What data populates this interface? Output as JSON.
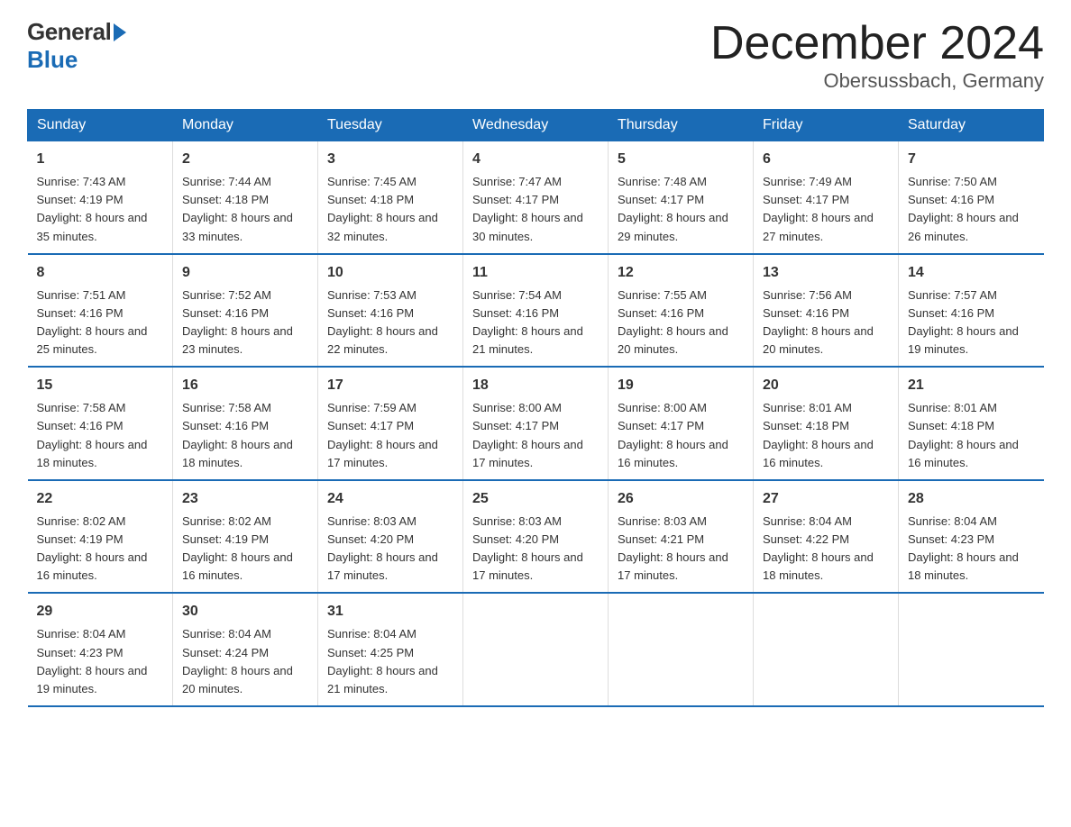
{
  "header": {
    "logo_text": "General",
    "logo_blue": "Blue",
    "month_title": "December 2024",
    "location": "Obersussbach, Germany"
  },
  "weekdays": [
    "Sunday",
    "Monday",
    "Tuesday",
    "Wednesday",
    "Thursday",
    "Friday",
    "Saturday"
  ],
  "weeks": [
    [
      {
        "day": "1",
        "sunrise": "7:43 AM",
        "sunset": "4:19 PM",
        "daylight": "8 hours and 35 minutes."
      },
      {
        "day": "2",
        "sunrise": "7:44 AM",
        "sunset": "4:18 PM",
        "daylight": "8 hours and 33 minutes."
      },
      {
        "day": "3",
        "sunrise": "7:45 AM",
        "sunset": "4:18 PM",
        "daylight": "8 hours and 32 minutes."
      },
      {
        "day": "4",
        "sunrise": "7:47 AM",
        "sunset": "4:17 PM",
        "daylight": "8 hours and 30 minutes."
      },
      {
        "day": "5",
        "sunrise": "7:48 AM",
        "sunset": "4:17 PM",
        "daylight": "8 hours and 29 minutes."
      },
      {
        "day": "6",
        "sunrise": "7:49 AM",
        "sunset": "4:17 PM",
        "daylight": "8 hours and 27 minutes."
      },
      {
        "day": "7",
        "sunrise": "7:50 AM",
        "sunset": "4:16 PM",
        "daylight": "8 hours and 26 minutes."
      }
    ],
    [
      {
        "day": "8",
        "sunrise": "7:51 AM",
        "sunset": "4:16 PM",
        "daylight": "8 hours and 25 minutes."
      },
      {
        "day": "9",
        "sunrise": "7:52 AM",
        "sunset": "4:16 PM",
        "daylight": "8 hours and 23 minutes."
      },
      {
        "day": "10",
        "sunrise": "7:53 AM",
        "sunset": "4:16 PM",
        "daylight": "8 hours and 22 minutes."
      },
      {
        "day": "11",
        "sunrise": "7:54 AM",
        "sunset": "4:16 PM",
        "daylight": "8 hours and 21 minutes."
      },
      {
        "day": "12",
        "sunrise": "7:55 AM",
        "sunset": "4:16 PM",
        "daylight": "8 hours and 20 minutes."
      },
      {
        "day": "13",
        "sunrise": "7:56 AM",
        "sunset": "4:16 PM",
        "daylight": "8 hours and 20 minutes."
      },
      {
        "day": "14",
        "sunrise": "7:57 AM",
        "sunset": "4:16 PM",
        "daylight": "8 hours and 19 minutes."
      }
    ],
    [
      {
        "day": "15",
        "sunrise": "7:58 AM",
        "sunset": "4:16 PM",
        "daylight": "8 hours and 18 minutes."
      },
      {
        "day": "16",
        "sunrise": "7:58 AM",
        "sunset": "4:16 PM",
        "daylight": "8 hours and 18 minutes."
      },
      {
        "day": "17",
        "sunrise": "7:59 AM",
        "sunset": "4:17 PM",
        "daylight": "8 hours and 17 minutes."
      },
      {
        "day": "18",
        "sunrise": "8:00 AM",
        "sunset": "4:17 PM",
        "daylight": "8 hours and 17 minutes."
      },
      {
        "day": "19",
        "sunrise": "8:00 AM",
        "sunset": "4:17 PM",
        "daylight": "8 hours and 16 minutes."
      },
      {
        "day": "20",
        "sunrise": "8:01 AM",
        "sunset": "4:18 PM",
        "daylight": "8 hours and 16 minutes."
      },
      {
        "day": "21",
        "sunrise": "8:01 AM",
        "sunset": "4:18 PM",
        "daylight": "8 hours and 16 minutes."
      }
    ],
    [
      {
        "day": "22",
        "sunrise": "8:02 AM",
        "sunset": "4:19 PM",
        "daylight": "8 hours and 16 minutes."
      },
      {
        "day": "23",
        "sunrise": "8:02 AM",
        "sunset": "4:19 PM",
        "daylight": "8 hours and 16 minutes."
      },
      {
        "day": "24",
        "sunrise": "8:03 AM",
        "sunset": "4:20 PM",
        "daylight": "8 hours and 17 minutes."
      },
      {
        "day": "25",
        "sunrise": "8:03 AM",
        "sunset": "4:20 PM",
        "daylight": "8 hours and 17 minutes."
      },
      {
        "day": "26",
        "sunrise": "8:03 AM",
        "sunset": "4:21 PM",
        "daylight": "8 hours and 17 minutes."
      },
      {
        "day": "27",
        "sunrise": "8:04 AM",
        "sunset": "4:22 PM",
        "daylight": "8 hours and 18 minutes."
      },
      {
        "day": "28",
        "sunrise": "8:04 AM",
        "sunset": "4:23 PM",
        "daylight": "8 hours and 18 minutes."
      }
    ],
    [
      {
        "day": "29",
        "sunrise": "8:04 AM",
        "sunset": "4:23 PM",
        "daylight": "8 hours and 19 minutes."
      },
      {
        "day": "30",
        "sunrise": "8:04 AM",
        "sunset": "4:24 PM",
        "daylight": "8 hours and 20 minutes."
      },
      {
        "day": "31",
        "sunrise": "8:04 AM",
        "sunset": "4:25 PM",
        "daylight": "8 hours and 21 minutes."
      },
      null,
      null,
      null,
      null
    ]
  ]
}
